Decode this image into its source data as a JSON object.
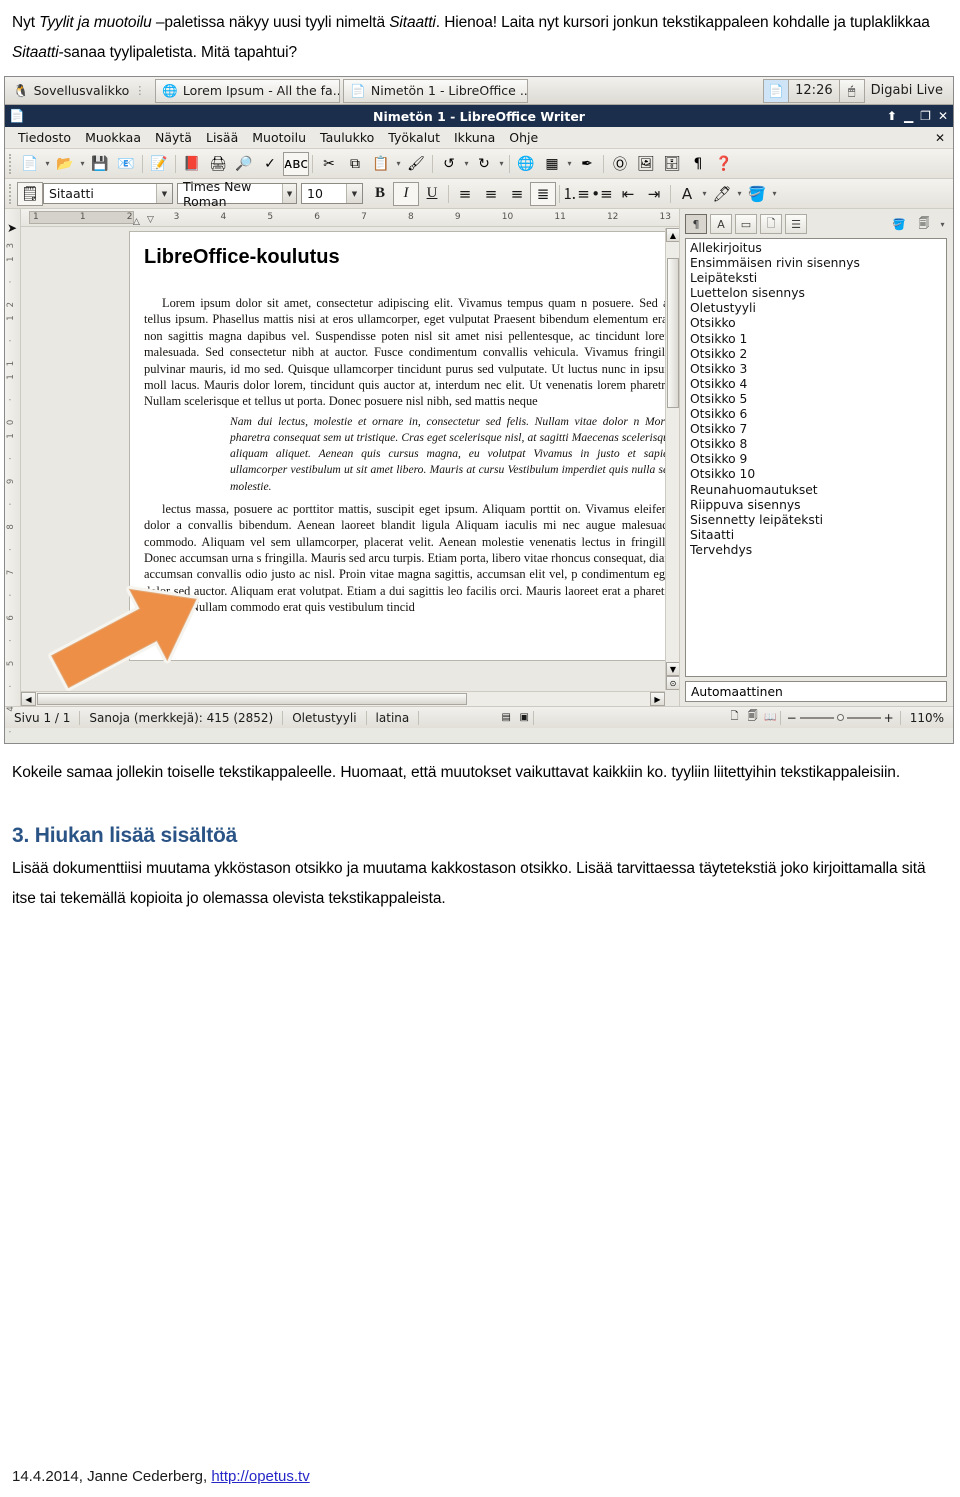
{
  "intro": {
    "line1_a": "Nyt ",
    "line1_em": "Tyylit ja muotoilu",
    "line1_b": " –paletissa näkyy uusi tyyli nimeltä ",
    "line1_em2": "Sitaatti",
    "line1_c": ". Hienoa! Laita nyt kursori jonkun tekstikappaleen kohdalle ja tuplaklikkaa ",
    "line1_em3": "Sitaatti",
    "line1_d": "-sanaa tyylipaletista. Mitä tapahtui?"
  },
  "after_figure": "Kokeile samaa jollekin toiselle tekstikappaleelle. Huomaat, että muutokset vaikuttavat kaikkiin ko. tyyliin liitettyihin tekstikappaleisiin.",
  "section": {
    "heading": "3. Hiukan lisää sisältöä",
    "body": "Lisää dokumenttiisi muutama ykköstason otsikko ja muutama kakkostason otsikko. Lisää tarvittaessa täytetekstiä joko kirjoittamalla sitä itse tai tekemällä kopioita jo olemassa olevista tekstikappaleista."
  },
  "footer": {
    "date_author": "14.4.2014, Janne Cederberg, ",
    "link": "http://opetus.tv"
  },
  "screenshot": {
    "taskbar": {
      "menu_label": "Sovellusvalikko",
      "windows": [
        {
          "label": "Lorem Ipsum - All the fa..."
        },
        {
          "label": "Nimetön 1 - LibreOffice ..."
        }
      ],
      "clock": "12:26",
      "session_label": "Digabi Live"
    },
    "titlebar": {
      "title": "Nimetön 1 - LibreOffice Writer",
      "buttons": [
        "shade",
        "minimize",
        "maximize",
        "close"
      ]
    },
    "menubar": {
      "items": [
        {
          "label": "Tiedosto",
          "accel": "T"
        },
        {
          "label": "Muokkaa",
          "accel": "M"
        },
        {
          "label": "Näytä",
          "accel": "N"
        },
        {
          "label": "Lisää",
          "accel": "L"
        },
        {
          "label": "Muotoilu",
          "accel": "u"
        },
        {
          "label": "Taulukko",
          "accel": "T"
        },
        {
          "label": "Työkalut",
          "accel": "y"
        },
        {
          "label": "Ikkuna",
          "accel": "I"
        },
        {
          "label": "Ohje",
          "accel": "O"
        }
      ],
      "close_doc": "✕"
    },
    "toolbar_standard": [
      {
        "name": "new-document-icon",
        "glyph": "📄",
        "dropdown": true
      },
      {
        "name": "open-document-icon",
        "glyph": "📂",
        "dropdown": true
      },
      {
        "name": "save-icon",
        "glyph": "💾",
        "dropdown": false
      },
      {
        "name": "email-document-icon",
        "glyph": "✉",
        "dropdown": false
      },
      {
        "name": "edit-mode-icon",
        "glyph": "📝",
        "dropdown": false
      },
      {
        "name": "export-pdf-icon",
        "glyph": "📕",
        "dropdown": false
      },
      {
        "name": "print-icon",
        "glyph": "🖨",
        "dropdown": false
      },
      {
        "name": "print-preview-icon",
        "glyph": "🔍",
        "dropdown": false
      },
      {
        "name": "spelling-icon",
        "glyph": "ABC",
        "dropdown": false
      },
      {
        "name": "autospellcheck-icon",
        "glyph": "ABC",
        "dropdown": false
      },
      {
        "name": "cut-icon",
        "glyph": "✂",
        "dropdown": false
      },
      {
        "name": "copy-icon",
        "glyph": "⧉",
        "dropdown": false
      },
      {
        "name": "paste-icon",
        "glyph": "📋",
        "dropdown": true
      },
      {
        "name": "clone-formatting-icon",
        "glyph": "🖌",
        "dropdown": false
      },
      {
        "name": "undo-icon",
        "glyph": "↶",
        "dropdown": true
      },
      {
        "name": "redo-icon",
        "glyph": "↷",
        "dropdown": true
      },
      {
        "name": "hyperlink-icon",
        "glyph": "🌐",
        "dropdown": false
      },
      {
        "name": "insert-table-icon",
        "glyph": "▦",
        "dropdown": true
      },
      {
        "name": "draw-functions-icon",
        "glyph": "✎",
        "dropdown": false
      },
      {
        "name": "special-character-icon",
        "glyph": "Ω",
        "dropdown": false
      },
      {
        "name": "insert-image-icon",
        "glyph": "🖼",
        "dropdown": false
      },
      {
        "name": "data-sources-icon",
        "glyph": "🗄",
        "dropdown": false
      },
      {
        "name": "formatting-marks-icon",
        "glyph": "¶",
        "dropdown": false
      },
      {
        "name": "help-icon",
        "glyph": "?",
        "dropdown": false
      }
    ],
    "toolbar_formatting": {
      "paragraph_style_value": "Sitaatti",
      "font_name_value": "Times New Roman",
      "font_size_value": "10",
      "bold_label": "B",
      "italic_label": "I",
      "underline_label": "U",
      "align_left": "align-left-icon",
      "align_center": "align-center-icon",
      "align_right": "align-right-icon",
      "align_justify": "align-justify-icon",
      "ordered_list": "ordered-list-icon",
      "unordered_list": "unordered-list-icon",
      "decrease_indent": "decrease-indent-icon",
      "increase_indent": "increase-indent-icon",
      "font_color": "font-color-icon",
      "highlight_color": "highlight-color-icon",
      "background_color": "background-color-icon"
    },
    "ruler": {
      "horizontal_ticks": [
        "1",
        "1",
        "2",
        "3",
        "4",
        "5",
        "6",
        "7",
        "8",
        "9",
        "10",
        "11",
        "12",
        "13",
        "1"
      ],
      "vertical_ticks": "3 · 4 · 5 · 6 · 7 · 8 · 9 · 10 · 11 · 12 · 13"
    },
    "document": {
      "heading": "LibreOffice-koulutus",
      "paragraph1": "Lorem ipsum dolor sit amet, consectetur adipiscing elit. Vivamus tempus quam n posuere. Sed ac tellus ipsum. Phasellus mattis nisi at eros ullamcorper, eget vulputat Praesent bibendum elementum erat, non sagittis magna dapibus vel. Suspendisse poten nisl sit amet nisi pellentesque, ac tincidunt lorem malesuada. Sed consectetur nibh at auctor. Fusce condimentum convallis vehicula. Vivamus fringilla pulvinar mauris, id mo sed. Quisque ullamcorper tincidunt purus sed vulputate. Ut luctus nunc in ipsum moll lacus. Mauris dolor lorem, tincidunt quis auctor at, interdum nec elit. Ut venenatis lorem pharetra. Nullam scelerisque et tellus ut porta. Donec posuere nisl nibh, sed mattis neque",
      "quote": "Nam dui lectus, molestie et ornare in, consectetur sed felis. Nullam vitae dolor n Morbi pharetra consequat sem ut tristique. Cras eget scelerisque nisl, at sagitti Maecenas scelerisque aliquam aliquet. Aenean quis cursus magna, eu volutpat Vivamus in justo et sapien ullamcorper vestibulum ut sit amet libero. Mauris at cursu Vestibulum imperdiet quis nulla sed molestie.",
      "paragraph2": "lectus massa, posuere ac porttitor mattis, suscipit eget ipsum. Aliquam porttit on. Vivamus eleifend dolor a convallis bibendum. Aenean laoreet blandit ligula Aliquam iaculis mi nec augue malesuada commodo. Aliquam vel sem ullamcorper, placerat velit. Aenean molestie venenatis lectus in fringilla. Donec accumsan urna s fringilla. Mauris sed arcu turpis. Etiam porta, libero vitae rhoncus consequat, diam accumsan convallis odio justo ac nisl. Proin vitae magna sagittis, accumsan elit vel, p condimentum eget dolor sed auctor. Aliquam erat volutpat. Etiam a dui sagittis leo facilis orci. Mauris laoreet erat a pharetra fringilla. Nullam commodo erat quis vestibulum tincid"
    },
    "styles_panel": {
      "tabs": [
        {
          "name": "paragraph-styles-icon",
          "selected": true
        },
        {
          "name": "character-styles-icon",
          "selected": false
        },
        {
          "name": "frame-styles-icon",
          "selected": false
        },
        {
          "name": "page-styles-icon",
          "selected": false
        },
        {
          "name": "list-styles-icon",
          "selected": false
        }
      ],
      "fill_format_icon": "fill-format-mode-icon",
      "new_style_icon": "new-style-from-selection-icon",
      "items": [
        "Allekirjoitus",
        "Ensimmäisen rivin sisennys",
        "Leipäteksti",
        "Luettelon sisennys",
        "Oletustyyli",
        "Otsikko",
        "Otsikko 1",
        "Otsikko 2",
        "Otsikko 3",
        "Otsikko 4",
        "Otsikko 5",
        "Otsikko 6",
        "Otsikko 7",
        "Otsikko 8",
        "Otsikko 9",
        "Otsikko 10",
        "Reunahuomautukset",
        "Riippuva sisennys",
        "Sisennetty leipäteksti",
        "Sitaatti",
        "Tervehdys"
      ],
      "selected_item": "Sitaatti",
      "filter_value": "Automaattinen"
    },
    "statusbar": {
      "page": "Sivu 1 / 1",
      "words": "Sanoja (merkkejä): 415 (2852)",
      "page_style": "Oletustyyli",
      "language": "latina",
      "insert_mode": "insert-mode-icon",
      "selection_mode": "selection-mode-icon",
      "view_single": "single-page-view-icon",
      "view_multi": "multi-page-view-icon",
      "view_book": "book-view-icon",
      "zoom_out": "−",
      "zoom_in": "+",
      "zoom_value": "110%"
    },
    "annotation": {
      "arrow_color": "#ED8F47",
      "arrow_outline": "#f2f1ec"
    }
  }
}
